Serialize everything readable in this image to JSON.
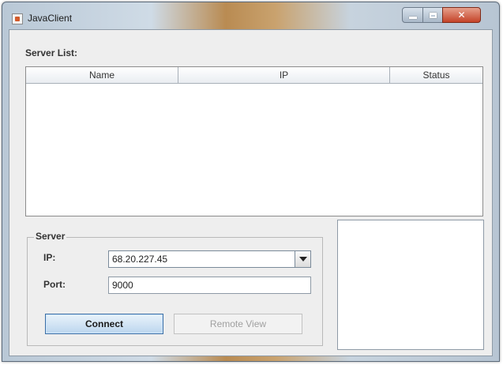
{
  "window": {
    "title": "JavaClient",
    "title_icon": "java-app-icon"
  },
  "server_list": {
    "label": "Server List:",
    "columns": [
      "Name",
      "IP",
      "Status"
    ],
    "rows": []
  },
  "server_group": {
    "title": "Server",
    "ip_label": "IP:",
    "ip_value": "68.20.227.45",
    "port_label": "Port:",
    "port_value": "9000"
  },
  "buttons": {
    "connect_label": "Connect",
    "remote_view_label": "Remote View"
  },
  "colors": {
    "connect_border": "#3b6ea5",
    "close_button": "#c44328"
  }
}
